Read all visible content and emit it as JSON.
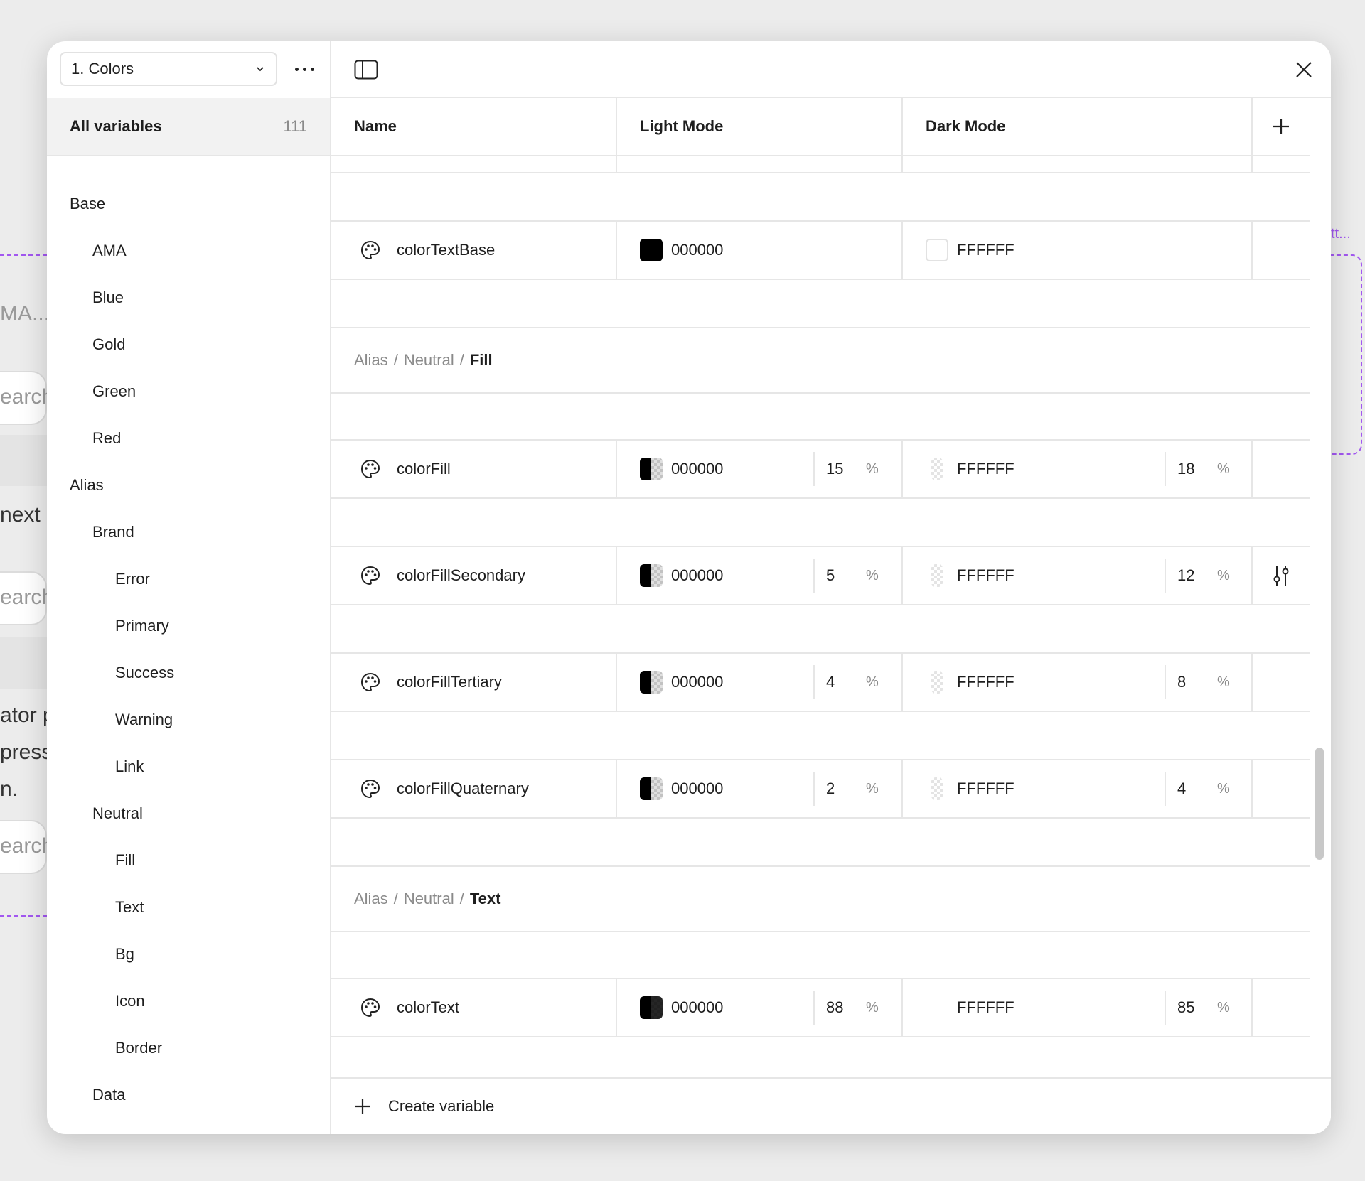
{
  "background": {
    "snippets": [
      "MA...",
      "earch",
      "next",
      "earch",
      "ator p",
      "press",
      "n.",
      "earch"
    ],
    "purple_label": "tt..."
  },
  "sidebar": {
    "collection": "1. Colors",
    "all_variables_label": "All variables",
    "all_variables_count": "111",
    "tree": [
      {
        "label": "Base",
        "level": 0
      },
      {
        "label": "AMA",
        "level": 1
      },
      {
        "label": "Blue",
        "level": 1
      },
      {
        "label": "Gold",
        "level": 1
      },
      {
        "label": "Green",
        "level": 1
      },
      {
        "label": "Red",
        "level": 1
      },
      {
        "label": "Alias",
        "level": 0
      },
      {
        "label": "Brand",
        "level": 1
      },
      {
        "label": "Error",
        "level": 2
      },
      {
        "label": "Primary",
        "level": 2
      },
      {
        "label": "Success",
        "level": 2
      },
      {
        "label": "Warning",
        "level": 2
      },
      {
        "label": "Link",
        "level": 2
      },
      {
        "label": "Neutral",
        "level": 1
      },
      {
        "label": "Fill",
        "level": 2
      },
      {
        "label": "Text",
        "level": 2
      },
      {
        "label": "Bg",
        "level": 2
      },
      {
        "label": "Icon",
        "level": 2
      },
      {
        "label": "Border",
        "level": 2
      },
      {
        "label": "Data",
        "level": 1
      }
    ]
  },
  "table": {
    "headers": {
      "name": "Name",
      "light": "Light Mode",
      "dark": "Dark Mode"
    },
    "row_text_base": {
      "name": "colorTextBase",
      "light_hex": "000000",
      "dark_hex": "FFFFFF"
    },
    "group_fill": {
      "parts": [
        "Alias",
        "Neutral"
      ],
      "last": "Fill",
      "sep": "/"
    },
    "fill_rows": [
      {
        "name": "colorFill",
        "light_hex": "000000",
        "light_pct": "15",
        "dark_hex": "FFFFFF",
        "dark_pct": "18",
        "pct_sign": "%"
      },
      {
        "name": "colorFillSecondary",
        "light_hex": "000000",
        "light_pct": "5",
        "dark_hex": "FFFFFF",
        "dark_pct": "12",
        "pct_sign": "%"
      },
      {
        "name": "colorFillTertiary",
        "light_hex": "000000",
        "light_pct": "4",
        "dark_hex": "FFFFFF",
        "dark_pct": "8",
        "pct_sign": "%"
      },
      {
        "name": "colorFillQuaternary",
        "light_hex": "000000",
        "light_pct": "2",
        "dark_hex": "FFFFFF",
        "dark_pct": "4",
        "pct_sign": "%"
      }
    ],
    "group_text": {
      "parts": [
        "Alias",
        "Neutral"
      ],
      "last": "Text",
      "sep": "/"
    },
    "row_text": {
      "name": "colorText",
      "light_hex": "000000",
      "light_pct": "88",
      "dark_hex": "FFFFFF",
      "dark_pct": "85",
      "pct_sign": "%"
    }
  },
  "footer": {
    "create_label": "Create variable"
  },
  "colors": {
    "accent": "#a257f0",
    "border": "#e6e6e6",
    "muted": "#8a8a8a"
  },
  "icons": [
    "chevron-down-icon",
    "more-icon",
    "sidebar-toggle-icon",
    "close-icon",
    "plus-icon",
    "palette-icon",
    "adjust-icon"
  ]
}
